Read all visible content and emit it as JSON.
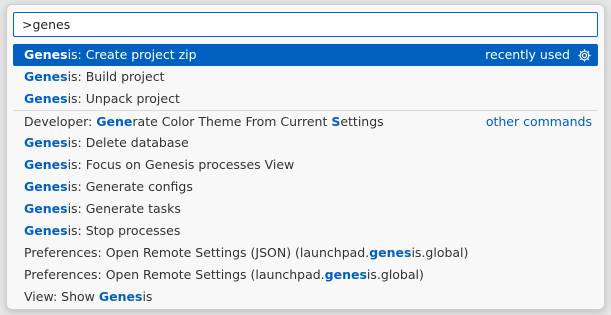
{
  "search": {
    "value": ">genes"
  },
  "items": [
    {
      "parts": [
        {
          "t": "Genes",
          "h": true
        },
        {
          "t": "is: Create project zip"
        }
      ],
      "detail": "recently used",
      "icon": "gear-icon",
      "selected": true
    },
    {
      "parts": [
        {
          "t": "Genes",
          "h": true
        },
        {
          "t": "is: Build project"
        }
      ]
    },
    {
      "parts": [
        {
          "t": "Genes",
          "h": true
        },
        {
          "t": "is: Unpack project"
        }
      ]
    },
    {
      "parts": [
        {
          "t": "Developer: "
        },
        {
          "t": "Gene",
          "h": true
        },
        {
          "t": "rate Color Theme From Current "
        },
        {
          "t": "S",
          "h": true
        },
        {
          "t": "ettings"
        }
      ],
      "group_label": "other commands",
      "separator": true
    },
    {
      "parts": [
        {
          "t": "Genes",
          "h": true
        },
        {
          "t": "is: Delete database"
        }
      ]
    },
    {
      "parts": [
        {
          "t": "Genes",
          "h": true
        },
        {
          "t": "is: Focus on Genesis processes View"
        }
      ]
    },
    {
      "parts": [
        {
          "t": "Genes",
          "h": true
        },
        {
          "t": "is: Generate configs"
        }
      ]
    },
    {
      "parts": [
        {
          "t": "Genes",
          "h": true
        },
        {
          "t": "is: Generate tasks"
        }
      ]
    },
    {
      "parts": [
        {
          "t": "Genes",
          "h": true
        },
        {
          "t": "is: Stop processes"
        }
      ]
    },
    {
      "parts": [
        {
          "t": "Preferences: Open Remote Settings (JSON) (launchpad."
        },
        {
          "t": "genes",
          "h": true
        },
        {
          "t": "is.global)"
        }
      ]
    },
    {
      "parts": [
        {
          "t": "Preferences: Open Remote Settings (launchpad."
        },
        {
          "t": "genes",
          "h": true
        },
        {
          "t": "is.global)"
        }
      ]
    },
    {
      "parts": [
        {
          "t": "View: Show "
        },
        {
          "t": "Genes",
          "h": true
        },
        {
          "t": "is"
        }
      ]
    }
  ],
  "colors": {
    "accent": "#0060c0",
    "selected_bg": "#0060c0",
    "input_border": "#0069c8"
  }
}
